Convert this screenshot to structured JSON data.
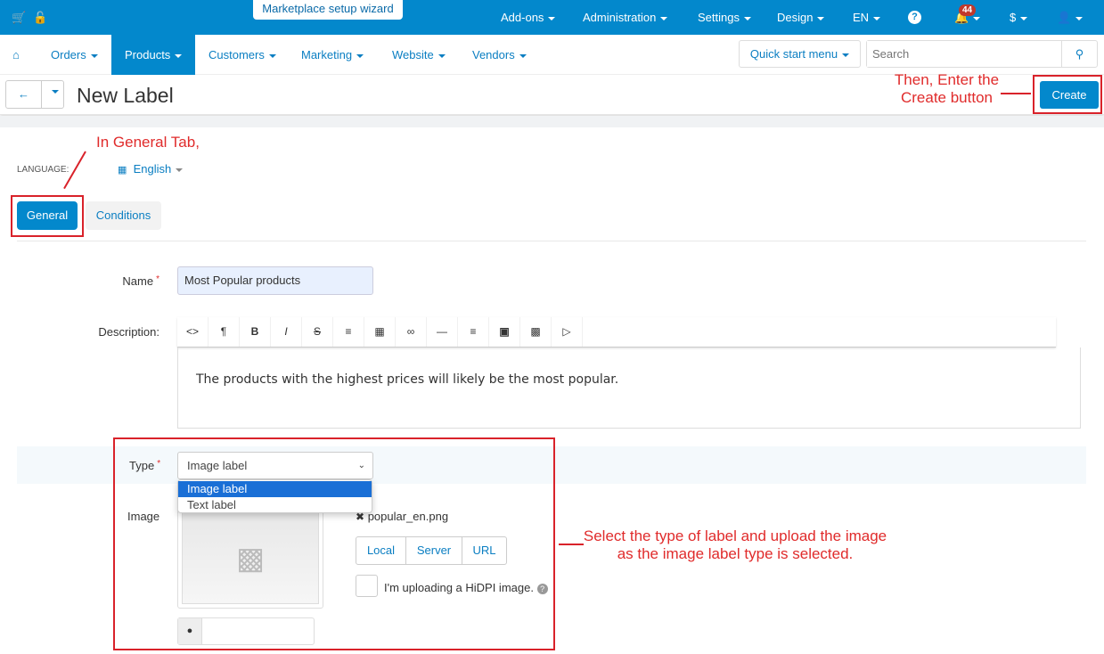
{
  "topbar": {
    "wizard": "Marketplace setup wizard",
    "menus": [
      "Add-ons",
      "Administration",
      "Settings",
      "Design",
      "EN"
    ],
    "notifications": "44",
    "currency": "$"
  },
  "nav": {
    "items": [
      "Orders",
      "Products",
      "Customers",
      "Marketing",
      "Website",
      "Vendors"
    ],
    "active": "Products",
    "quick_start": "Quick start menu",
    "search_placeholder": "Search"
  },
  "header": {
    "title": "New Label",
    "create": "Create"
  },
  "annotations": {
    "create": "Then, Enter the Create button",
    "general": "In General Tab,",
    "type": "Select the type of label and upload the image as the image label type is selected.",
    "color": "#d9222a"
  },
  "language": {
    "label": "LANGUAGE:",
    "value": "English"
  },
  "tabs": [
    "General",
    "Conditions"
  ],
  "form": {
    "name_label": "Name",
    "name_value": "Most Popular products",
    "description_label": "Description:",
    "description_text": "The products with the highest prices will likely be the most popular.",
    "toolbar": [
      "code",
      "paragraph",
      "bold",
      "italic",
      "strikethrough",
      "list",
      "table",
      "link",
      "horizontal-rule",
      "align",
      "font-color",
      "image",
      "video"
    ],
    "type_label": "Type",
    "type_value": "Image label",
    "type_options": [
      "Image label",
      "Text label"
    ],
    "image_label": "Image",
    "file_name": "popular_en.png",
    "sources": [
      "Local",
      "Server",
      "URL"
    ],
    "hidpi": "I'm uploading a HiDPI image."
  },
  "colors": {
    "primary": "#0388cc"
  }
}
